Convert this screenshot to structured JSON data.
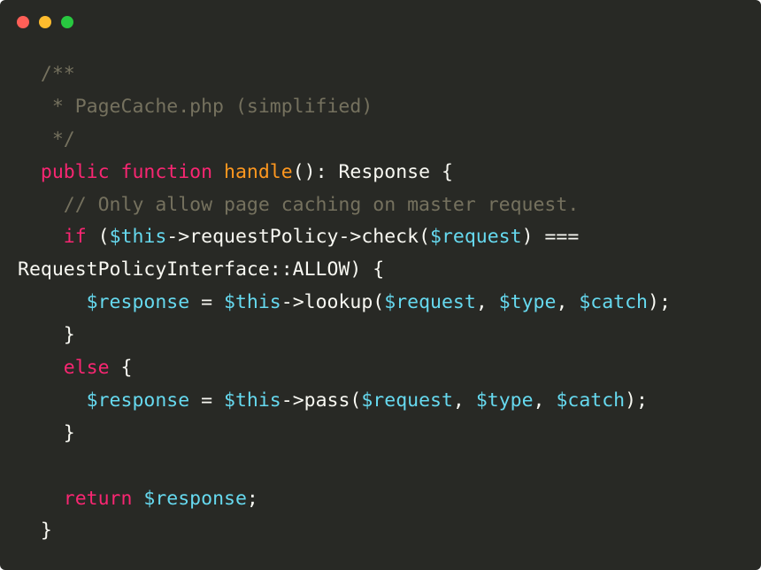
{
  "window": {
    "controls": [
      {
        "name": "close-button",
        "color": "#ff5f57"
      },
      {
        "name": "minimize-button",
        "color": "#febc2e"
      },
      {
        "name": "maximize-button",
        "color": "#28c840"
      }
    ]
  },
  "code": {
    "language": "php",
    "lines": [
      [
        {
          "t": "  /**",
          "c": "comment"
        }
      ],
      [
        {
          "t": "   * PageCache.php (simplified)",
          "c": "comment"
        }
      ],
      [
        {
          "t": "   */",
          "c": "comment"
        }
      ],
      [
        {
          "t": "  ",
          "c": "plain"
        },
        {
          "t": "public",
          "c": "kw"
        },
        {
          "t": " ",
          "c": "plain"
        },
        {
          "t": "function",
          "c": "kw"
        },
        {
          "t": " ",
          "c": "plain"
        },
        {
          "t": "handle",
          "c": "fn"
        },
        {
          "t": "(): Response {",
          "c": "plain"
        }
      ],
      [
        {
          "t": "    // Only allow page caching on master request.",
          "c": "comment"
        }
      ],
      [
        {
          "t": "    ",
          "c": "plain"
        },
        {
          "t": "if",
          "c": "kw"
        },
        {
          "t": " (",
          "c": "plain"
        },
        {
          "t": "$this",
          "c": "var"
        },
        {
          "t": "->requestPolicy->check(",
          "c": "plain"
        },
        {
          "t": "$request",
          "c": "var"
        },
        {
          "t": ") ===",
          "c": "plain"
        }
      ],
      [
        {
          "t": "RequestPolicyInterface::ALLOW) {",
          "c": "plain"
        }
      ],
      [
        {
          "t": "      ",
          "c": "plain"
        },
        {
          "t": "$response",
          "c": "var"
        },
        {
          "t": " = ",
          "c": "plain"
        },
        {
          "t": "$this",
          "c": "var"
        },
        {
          "t": "->lookup(",
          "c": "plain"
        },
        {
          "t": "$request",
          "c": "var"
        },
        {
          "t": ", ",
          "c": "plain"
        },
        {
          "t": "$type",
          "c": "var"
        },
        {
          "t": ", ",
          "c": "plain"
        },
        {
          "t": "$catch",
          "c": "var"
        },
        {
          "t": ");",
          "c": "plain"
        }
      ],
      [
        {
          "t": "    }",
          "c": "plain"
        }
      ],
      [
        {
          "t": "    ",
          "c": "plain"
        },
        {
          "t": "else",
          "c": "kw"
        },
        {
          "t": " {",
          "c": "plain"
        }
      ],
      [
        {
          "t": "      ",
          "c": "plain"
        },
        {
          "t": "$response",
          "c": "var"
        },
        {
          "t": " = ",
          "c": "plain"
        },
        {
          "t": "$this",
          "c": "var"
        },
        {
          "t": "->pass(",
          "c": "plain"
        },
        {
          "t": "$request",
          "c": "var"
        },
        {
          "t": ", ",
          "c": "plain"
        },
        {
          "t": "$type",
          "c": "var"
        },
        {
          "t": ", ",
          "c": "plain"
        },
        {
          "t": "$catch",
          "c": "var"
        },
        {
          "t": ");",
          "c": "plain"
        }
      ],
      [
        {
          "t": "    }",
          "c": "plain"
        }
      ],
      [
        {
          "t": "",
          "c": "plain"
        }
      ],
      [
        {
          "t": "    ",
          "c": "plain"
        },
        {
          "t": "return",
          "c": "kw"
        },
        {
          "t": " ",
          "c": "plain"
        },
        {
          "t": "$response",
          "c": "var"
        },
        {
          "t": ";",
          "c": "plain"
        }
      ],
      [
        {
          "t": "  }",
          "c": "plain"
        }
      ]
    ]
  },
  "colors": {
    "background": "#282925",
    "comment": "#75715e",
    "keyword": "#f92672",
    "function": "#fd971f",
    "variable": "#66d9ef",
    "plain": "#f8f8f2"
  }
}
